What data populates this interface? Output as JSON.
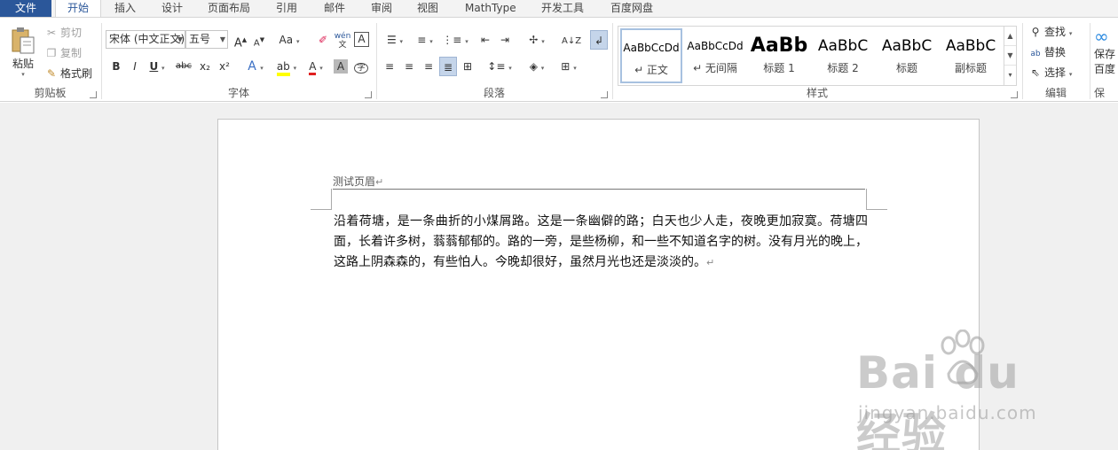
{
  "tabs": [
    "文件",
    "开始",
    "插入",
    "设计",
    "页面布局",
    "引用",
    "邮件",
    "审阅",
    "视图",
    "MathType",
    "开发工具",
    "百度网盘"
  ],
  "clipboard": {
    "paste_label": "粘贴",
    "cut_label": "剪切",
    "copy_label": "复制",
    "format_painter_label": "格式刷",
    "group_label": "剪贴板"
  },
  "font": {
    "font_name": "宋体 (中文正文)",
    "font_size": "五号",
    "group_label": "字体",
    "change_case": "Aa",
    "phonetic": "wén",
    "bold": "B",
    "italic": "I",
    "underline": "U",
    "strike": "abc",
    "subscript": "x₂",
    "superscript": "x²",
    "char_border": "A",
    "char_shading": "A",
    "enclose": "字",
    "grow": "A",
    "shrink": "A"
  },
  "paragraph": {
    "group_label": "段落"
  },
  "styles": {
    "group_label": "样式",
    "items": [
      {
        "preview": "AaBbCcDd",
        "name": "↵ 正文"
      },
      {
        "preview": "AaBbCcDd",
        "name": "↵ 无间隔"
      },
      {
        "preview": "AaBb",
        "name": "标题 1"
      },
      {
        "preview": "AaBbC",
        "name": "标题 2"
      },
      {
        "preview": "AaBbC",
        "name": "标题"
      },
      {
        "preview": "AaBbC",
        "name": "副标题"
      }
    ]
  },
  "editing": {
    "find_label": "查找",
    "replace_label": "替换",
    "select_label": "选择",
    "group_label": "编辑"
  },
  "baidu": {
    "save_label": "保存",
    "save_label2": "百度",
    "group_label": "保"
  },
  "document": {
    "header_text": "测试页眉",
    "body_text": "沿着荷塘，是一条曲折的小煤屑路。这是一条幽僻的路；白天也少人走，夜晚更加寂寞。荷塘四面，长着许多树，蓊蓊郁郁的。路的一旁，是些杨柳，和一些不知道名字的树。没有月光的晚上，这路上阴森森的，有些怕人。今晚却很好，虽然月光也还是淡淡的。"
  },
  "watermark": {
    "logo_text": "Bai du 经验",
    "url_text": "jingyan.baidu.com"
  },
  "colors": {
    "accent": "#2b579a",
    "highlight": "#ffff00",
    "font_color": "#e02020"
  }
}
